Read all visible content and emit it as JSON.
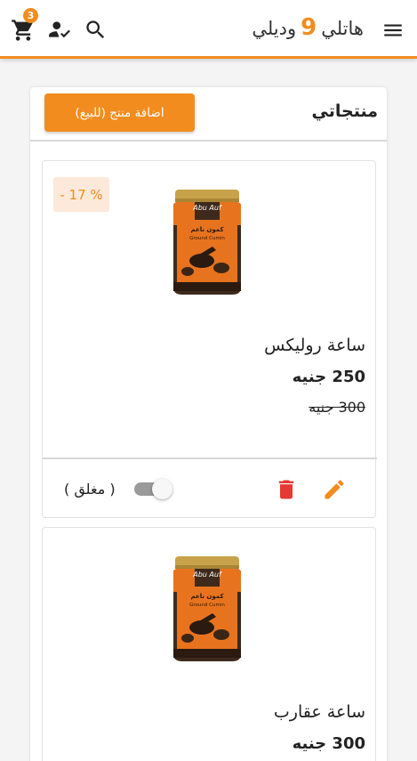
{
  "header": {
    "cart_count": "3",
    "logo_prefix": "هاتلي",
    "logo_number": "9",
    "logo_suffix": "وديلي",
    "icons": [
      "cart-icon",
      "user-check-icon",
      "search-icon",
      "menu-icon"
    ]
  },
  "panel": {
    "title": "منتجاتي",
    "add_button": "اضافة منتج (للبيع)"
  },
  "products": [
    {
      "discount": "% 17 -",
      "name": "ساعة روليكس",
      "price": "250 جنيه",
      "old_price": "300 جنيه",
      "status_label": "( مغلق )",
      "jar_brand": "Abu Auf",
      "jar_label_ar": "كمون ناعم",
      "jar_label_en": "Ground Cumin"
    },
    {
      "name": "ساعة عقارب",
      "price": "300 جنيه",
      "jar_brand": "Abu Auf",
      "jar_label_ar": "كمون ناعم",
      "jar_label_en": "Ground Cumin"
    }
  ],
  "colors": {
    "accent": "#f28c1e",
    "delete": "#e53935",
    "toggle_off": "#9a9a9a"
  }
}
